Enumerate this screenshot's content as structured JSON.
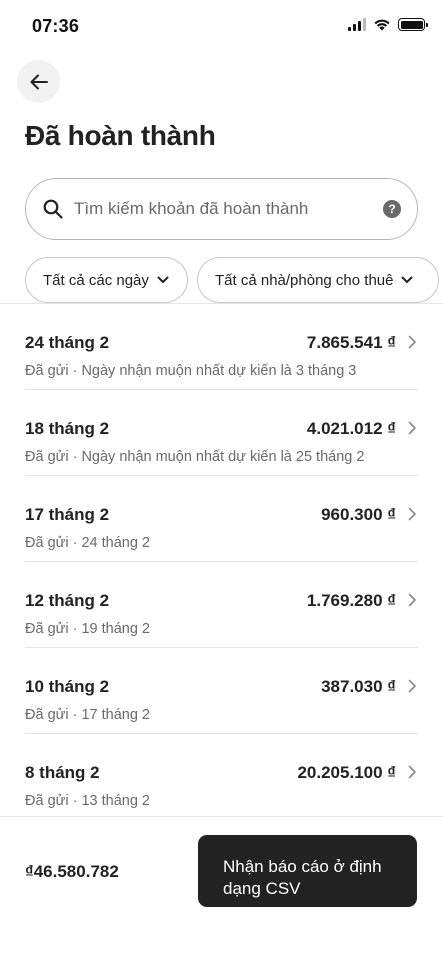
{
  "status_bar": {
    "time": "07:36"
  },
  "header": {
    "title": "Đã hoàn thành"
  },
  "search": {
    "placeholder": "Tìm kiếm khoản đã hoàn thành"
  },
  "filters": {
    "date_label": "Tất cả các ngày",
    "listing_label": "Tất cả nhà/phòng cho thuê"
  },
  "payouts": [
    {
      "date": "24 tháng 2",
      "amount": "7.865.541 ₫",
      "detail": "Đã gửi · Ngày nhận muộn nhất dự kiến là 3 tháng 3"
    },
    {
      "date": "18 tháng 2",
      "amount": "4.021.012 ₫",
      "detail": "Đã gửi · Ngày nhận muộn nhất dự kiến là 25 tháng 2"
    },
    {
      "date": "17 tháng 2",
      "amount": "960.300 ₫",
      "detail": "Đã gửi · 24 tháng 2"
    },
    {
      "date": "12 tháng 2",
      "amount": "1.769.280 ₫",
      "detail": "Đã gửi · 19 tháng 2"
    },
    {
      "date": "10 tháng 2",
      "amount": "387.030 ₫",
      "detail": "Đã gửi · 17 tháng 2"
    },
    {
      "date": "8 tháng 2",
      "amount": "20.205.100 ₫",
      "detail": "Đã gửi · 13 tháng 2"
    }
  ],
  "footer": {
    "total": "₫46.580.782",
    "csv_button": "Nhận báo cáo ở định dạng CSV"
  },
  "colors": {
    "text": "#222222",
    "secondary": "#6a6a6a",
    "button_bg": "#222222"
  },
  "icons": [
    "signal-icon",
    "wifi-icon",
    "battery-icon",
    "back-arrow-icon",
    "search-icon",
    "help-icon",
    "chevron-down-icon",
    "chevron-right-icon"
  ]
}
